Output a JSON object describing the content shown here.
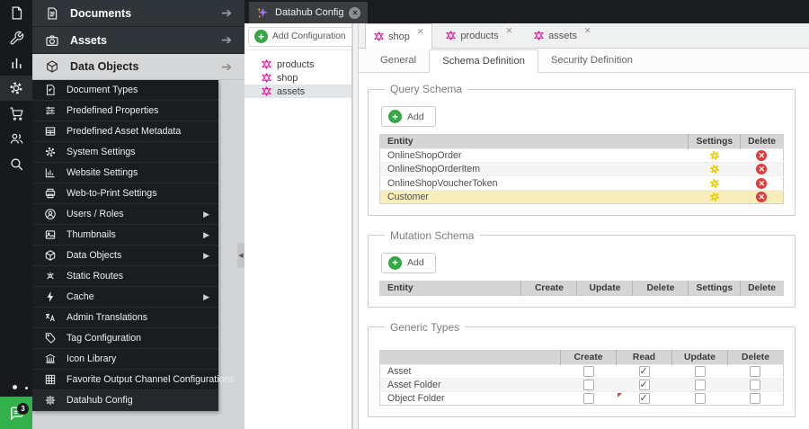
{
  "iconbar": {
    "icons": [
      "file",
      "wrench",
      "bar-chart",
      "gear",
      "shopping-cart",
      "users",
      "search"
    ],
    "chat_badge_count": "3"
  },
  "sidebar": {
    "accordion": [
      {
        "label": "Documents"
      },
      {
        "label": "Assets"
      },
      {
        "label": "Data Objects"
      }
    ],
    "items": [
      {
        "label": "Document Types"
      },
      {
        "label": "Predefined Properties"
      },
      {
        "label": "Predefined Asset Metadata"
      },
      {
        "label": "System Settings"
      },
      {
        "label": "Website Settings"
      },
      {
        "label": "Web-to-Print Settings"
      },
      {
        "label": "Users / Roles"
      },
      {
        "label": "Thumbnails"
      },
      {
        "label": "Data Objects"
      },
      {
        "label": "Static Routes"
      },
      {
        "label": "Cache"
      },
      {
        "label": "Admin Translations"
      },
      {
        "label": "Tag Configuration"
      },
      {
        "label": "Icon Library"
      },
      {
        "label": "Favorite Output Channel Configurations"
      },
      {
        "label": "Datahub Config"
      }
    ]
  },
  "workspace_tab": {
    "label": "Datahub Config"
  },
  "config_panel": {
    "add_button_label": "Add Configuration",
    "items": [
      {
        "label": "products"
      },
      {
        "label": "shop"
      },
      {
        "label": "assets"
      }
    ]
  },
  "main": {
    "tabs": [
      {
        "label": "shop"
      },
      {
        "label": "products"
      },
      {
        "label": "assets"
      }
    ],
    "subtabs": [
      {
        "label": "General"
      },
      {
        "label": "Schema Definition"
      },
      {
        "label": "Security Definition"
      }
    ],
    "query_schema": {
      "legend": "Query Schema",
      "add_label": "Add",
      "col_entity": "Entity",
      "col_settings": "Settings",
      "col_delete": "Delete",
      "rows": [
        {
          "entity": "OnlineShopOrder"
        },
        {
          "entity": "OnlineShopOrderItem"
        },
        {
          "entity": "OnlineShopVoucherToken"
        },
        {
          "entity": "Customer"
        }
      ]
    },
    "mutation_schema": {
      "legend": "Mutation Schema",
      "add_label": "Add",
      "columns": [
        "Entity",
        "Create",
        "Update",
        "Delete",
        "Settings",
        "Delete"
      ]
    },
    "generic_types": {
      "legend": "Generic Types",
      "columns": [
        "",
        "Create",
        "Read",
        "Update",
        "Delete"
      ],
      "rows": [
        {
          "label": "Asset",
          "create": false,
          "read": true,
          "update": false,
          "delete": false
        },
        {
          "label": "Asset Folder",
          "create": false,
          "read": true,
          "update": false,
          "delete": false
        },
        {
          "label": "Object Folder",
          "create": false,
          "read": true,
          "update": false,
          "delete": false,
          "dirty_read": true
        }
      ]
    }
  },
  "colors": {
    "accent_magenta": "#e10098",
    "add_green": "#35a845",
    "settings_yellow": "#eed202",
    "delete_red": "#e23b3b",
    "row_highlight": "#f8edbd",
    "sidebar_dark": "#1a1d20"
  }
}
